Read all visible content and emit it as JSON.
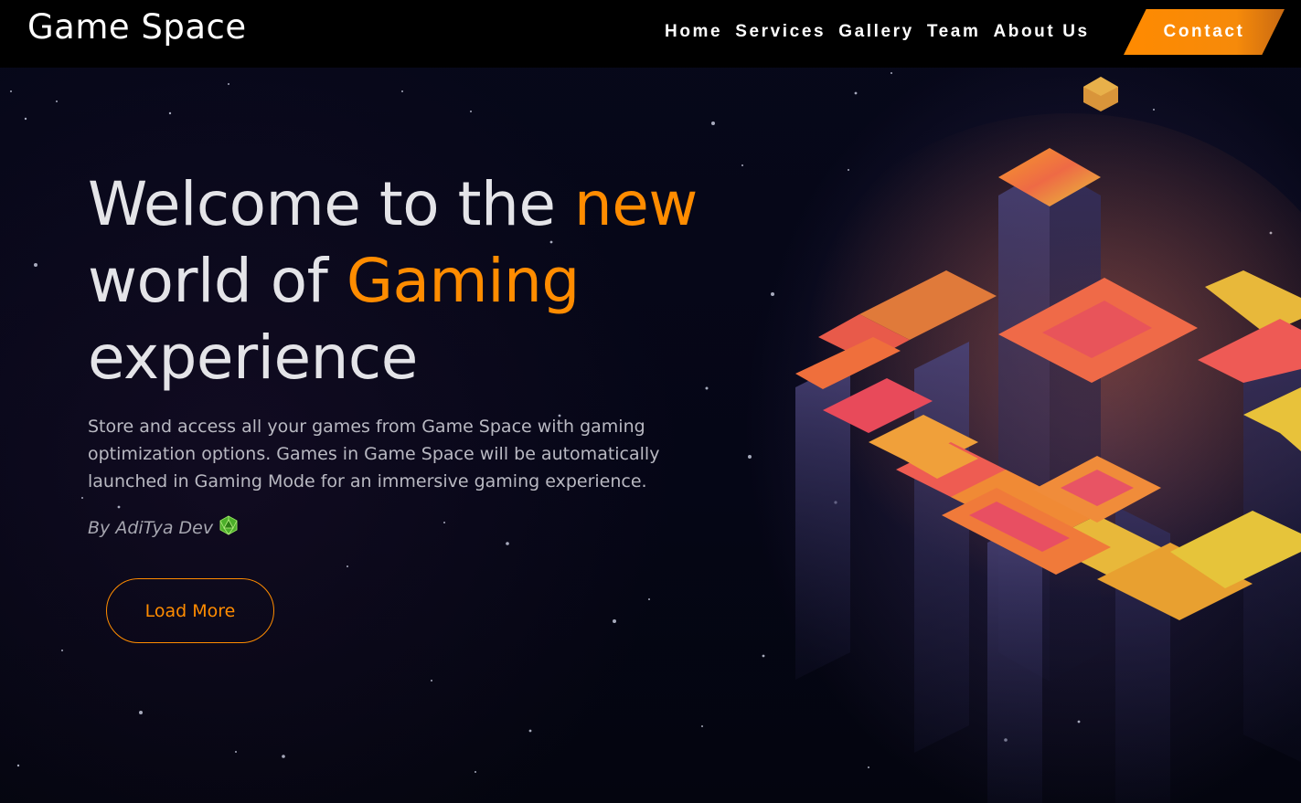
{
  "navbar": {
    "logo": "Game Space",
    "links": [
      "Home",
      "Services",
      "Gallery",
      "Team",
      "About Us"
    ],
    "contact_label": "Contact"
  },
  "hero": {
    "title_part1": "Welcome to the ",
    "title_highlight1": "new",
    "title_part2": "world of ",
    "title_highlight2": "Gaming",
    "title_part3": "experience",
    "description": "Store and access all your games from Game Space with gaming optimization options. Games in Game Space will be automatically launched in Gaming Mode for an immersive gaming experience.",
    "author": "By AdiTya Dev",
    "author_icon": "d20-dice-icon",
    "button_label": "Load More"
  },
  "colors": {
    "accent": "#ff8c00",
    "navbar_bg": "#000000",
    "page_bg": "#05060f",
    "text_primary": "#e4e4e8",
    "text_secondary": "#b9b9c2"
  },
  "illustration": "isometric-voxel-cubes"
}
